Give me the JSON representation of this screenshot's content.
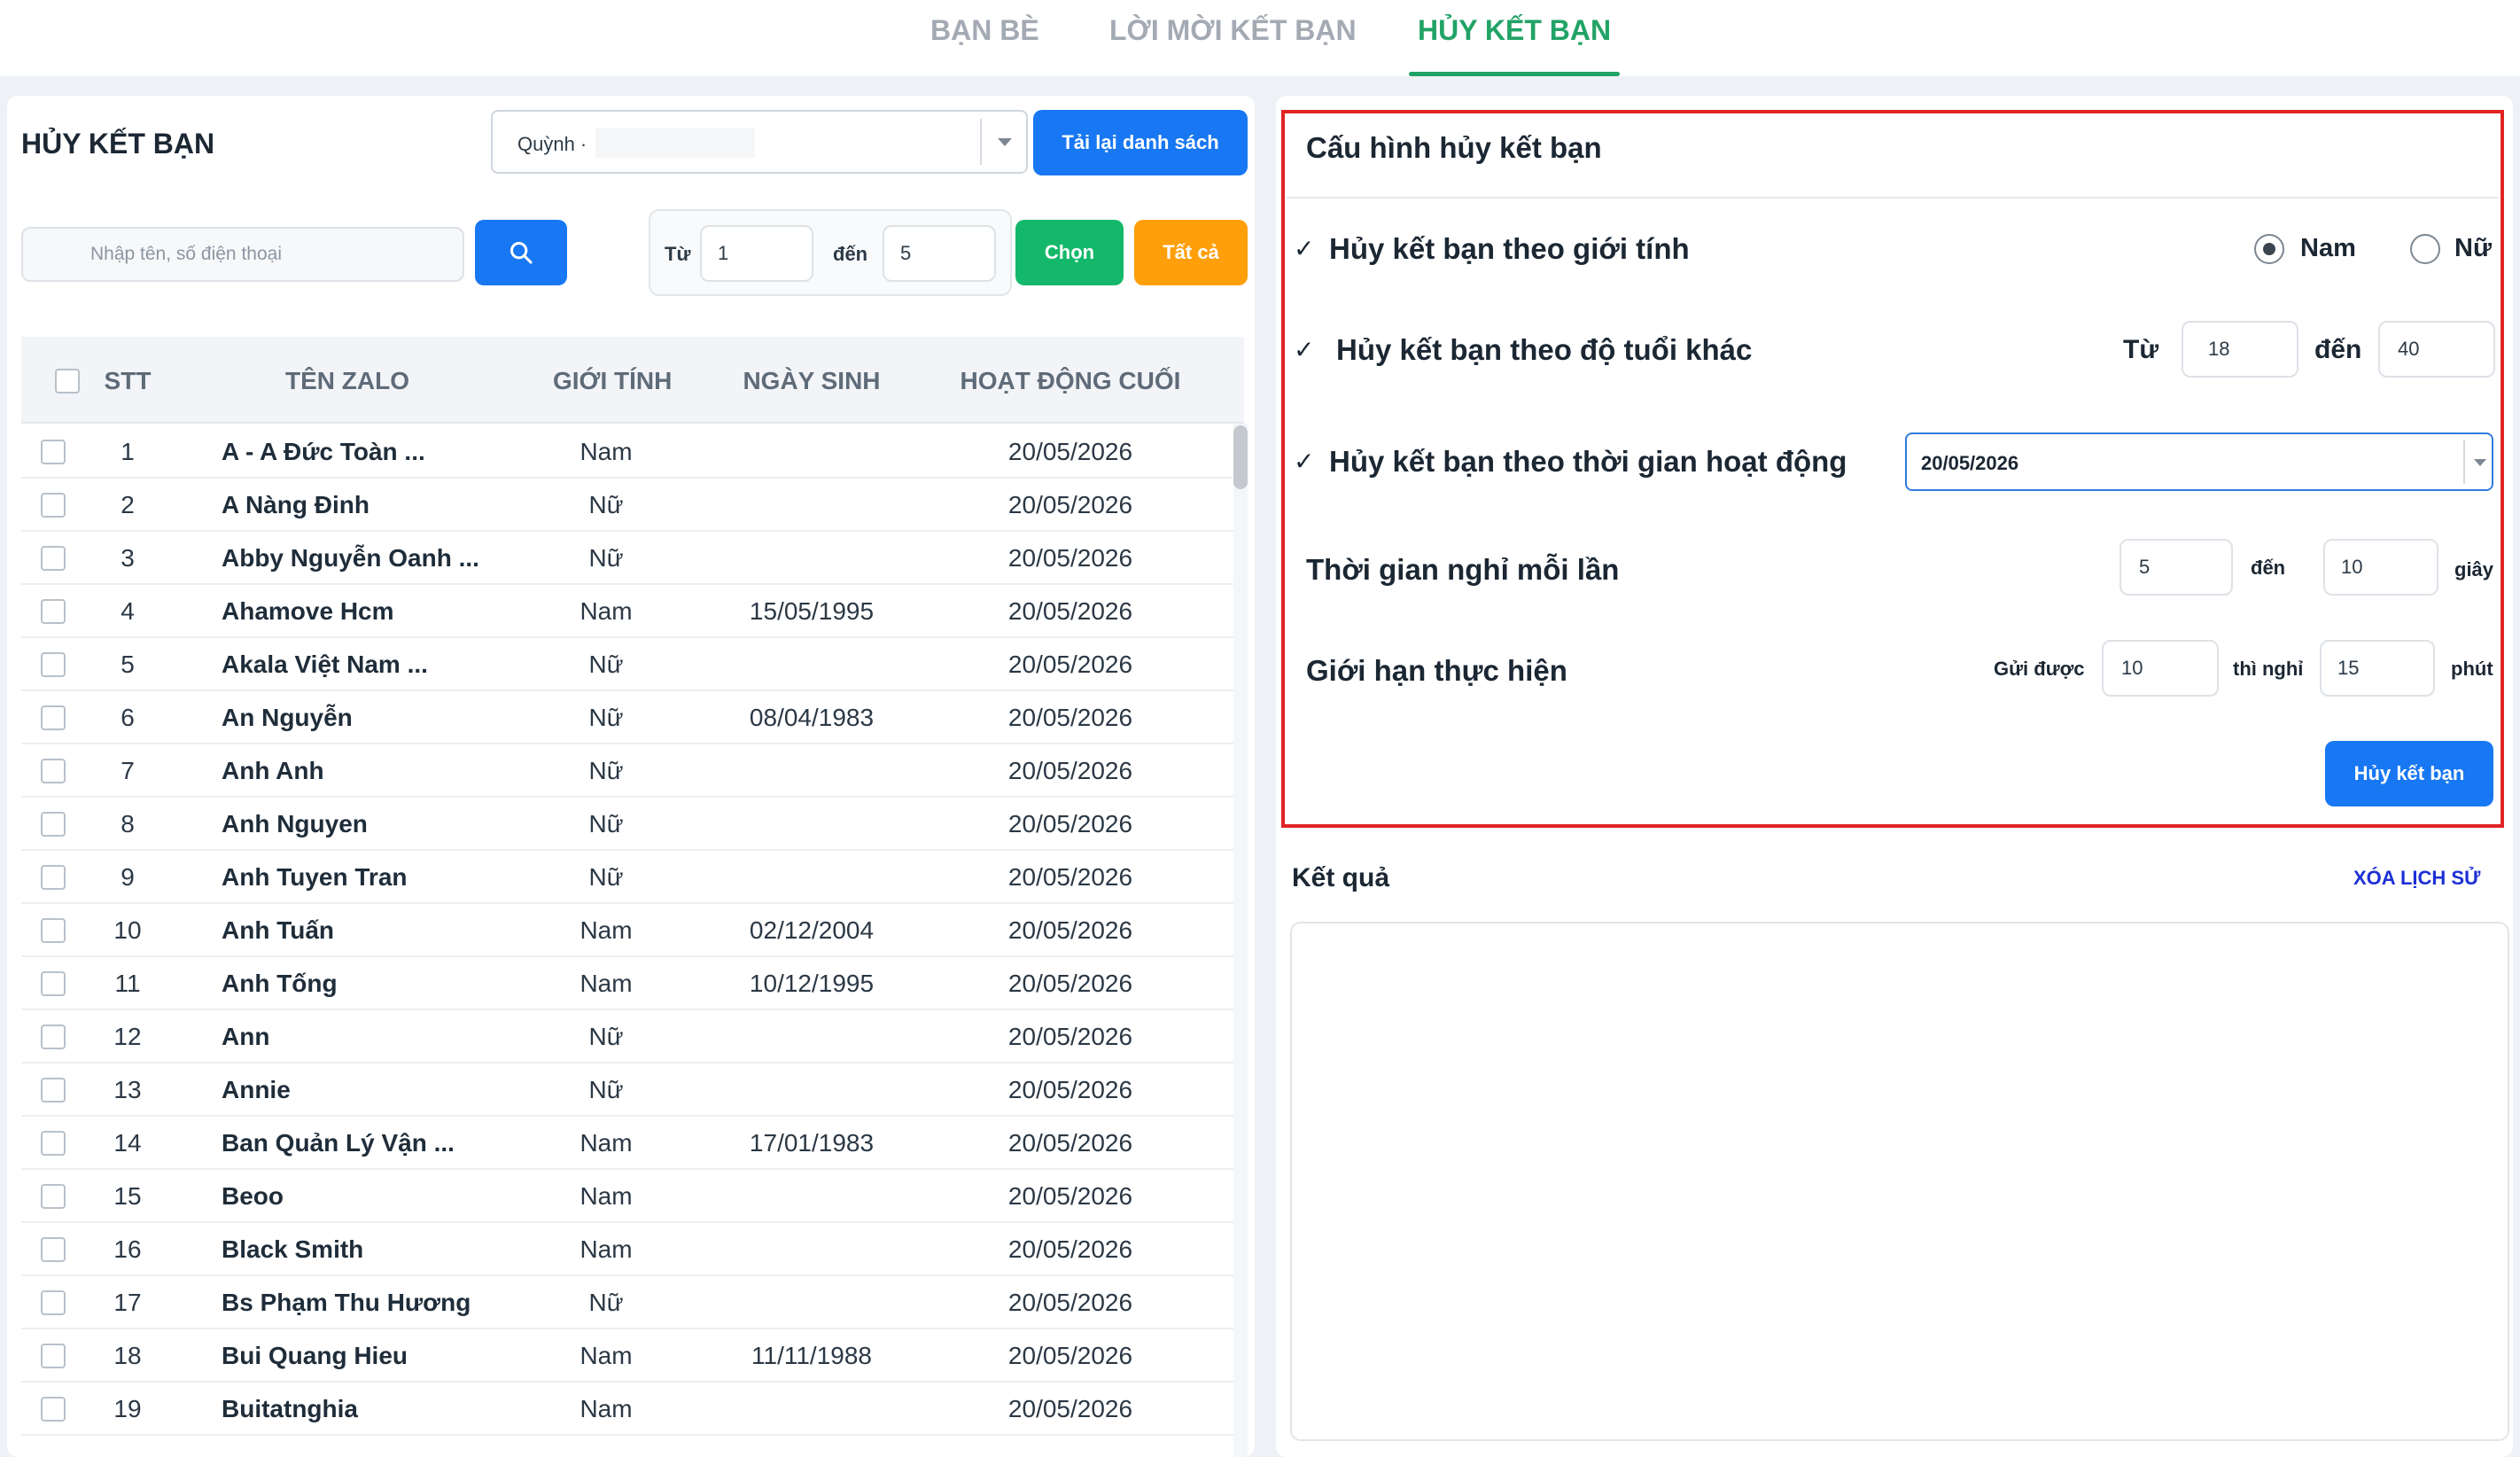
{
  "tabs": [
    {
      "label": "BẠN BÈ",
      "active": false
    },
    {
      "label": "LỜI MỜI KẾT BẠN",
      "active": false
    },
    {
      "label": "HỦY KẾT BẠN",
      "active": true
    }
  ],
  "left": {
    "title": "HỦY KẾT BẠN",
    "account_value": "Quỳnh ·",
    "reload_label": "Tải lại danh sách",
    "search_placeholder": "Nhập tên, số điện thoại",
    "range_from_label": "Từ",
    "range_from_value": "1",
    "range_to_label": "đến",
    "range_to_value": "5",
    "choose_label": "Chọn",
    "all_label": "Tất cả"
  },
  "table": {
    "headers": {
      "stt": "STT",
      "name": "TÊN ZALO",
      "gender": "GIỚI TÍNH",
      "birth": "NGÀY SINH",
      "last": "HOẠT ĐỘNG CUỐI"
    },
    "rows": [
      {
        "stt": "1",
        "name": "A - A Đức Toàn ...",
        "gender": "Nam",
        "birth": "",
        "last": "20/05/2026"
      },
      {
        "stt": "2",
        "name": "A Nàng Đinh",
        "gender": "Nữ",
        "birth": "",
        "last": "20/05/2026"
      },
      {
        "stt": "3",
        "name": "Abby Nguyễn Oanh ...",
        "gender": "Nữ",
        "birth": "",
        "last": "20/05/2026"
      },
      {
        "stt": "4",
        "name": "Ahamove Hcm",
        "gender": "Nam",
        "birth": "15/05/1995",
        "last": "20/05/2026"
      },
      {
        "stt": "5",
        "name": "Akala Việt Nam ...",
        "gender": "Nữ",
        "birth": "",
        "last": "20/05/2026"
      },
      {
        "stt": "6",
        "name": "An Nguyễn",
        "gender": "Nữ",
        "birth": "08/04/1983",
        "last": "20/05/2026"
      },
      {
        "stt": "7",
        "name": "Anh Anh",
        "gender": "Nữ",
        "birth": "",
        "last": "20/05/2026"
      },
      {
        "stt": "8",
        "name": "Anh Nguyen",
        "gender": "Nữ",
        "birth": "",
        "last": "20/05/2026"
      },
      {
        "stt": "9",
        "name": "Anh Tuyen Tran",
        "gender": "Nữ",
        "birth": "",
        "last": "20/05/2026"
      },
      {
        "stt": "10",
        "name": "Anh Tuấn",
        "gender": "Nam",
        "birth": "02/12/2004",
        "last": "20/05/2026"
      },
      {
        "stt": "11",
        "name": "Anh Tống",
        "gender": "Nam",
        "birth": "10/12/1995",
        "last": "20/05/2026"
      },
      {
        "stt": "12",
        "name": "Ann",
        "gender": "Nữ",
        "birth": "",
        "last": "20/05/2026"
      },
      {
        "stt": "13",
        "name": "Annie",
        "gender": "Nữ",
        "birth": "",
        "last": "20/05/2026"
      },
      {
        "stt": "14",
        "name": "Ban Quản Lý Vận ...",
        "gender": "Nam",
        "birth": "17/01/1983",
        "last": "20/05/2026"
      },
      {
        "stt": "15",
        "name": "Beoo",
        "gender": "Nam",
        "birth": "",
        "last": "20/05/2026"
      },
      {
        "stt": "16",
        "name": "Black Smith",
        "gender": "Nam",
        "birth": "",
        "last": "20/05/2026"
      },
      {
        "stt": "17",
        "name": "Bs Phạm Thu Hương",
        "gender": "Nữ",
        "birth": "",
        "last": "20/05/2026"
      },
      {
        "stt": "18",
        "name": "Bui Quang Hieu",
        "gender": "Nam",
        "birth": "11/11/1988",
        "last": "20/05/2026"
      },
      {
        "stt": "19",
        "name": "Buitatnghia",
        "gender": "Nam",
        "birth": "",
        "last": "20/05/2026"
      }
    ]
  },
  "config": {
    "title": "Cấu hình hủy kết bạn",
    "gender_rule": "Hủy kết bạn theo giới tính",
    "gender_male": "Nam",
    "gender_female": "Nữ",
    "age_rule": "Hủy kết bạn theo độ tuổi khác",
    "age_from_label": "Từ",
    "age_from": "18",
    "age_to_label": "đến",
    "age_to": "40",
    "activity_rule": "Hủy kết bạn theo thời gian hoạt động",
    "activity_date": "20/05/2026",
    "rest_label": "Thời gian nghỉ mỗi lần",
    "rest_from": "5",
    "rest_to_label": "đến",
    "rest_to": "10",
    "rest_unit": "giây",
    "limit_label": "Giới hạn thực hiện",
    "limit_send_label": "Gửi được",
    "limit_send": "10",
    "limit_rest_label": "thì nghỉ",
    "limit_rest": "15",
    "limit_unit": "phút",
    "submit_label": "Hủy kết bạn",
    "check_mark": "✓"
  },
  "result": {
    "title": "Kết quả",
    "clear_label": "XÓA LỊCH SỬ"
  }
}
